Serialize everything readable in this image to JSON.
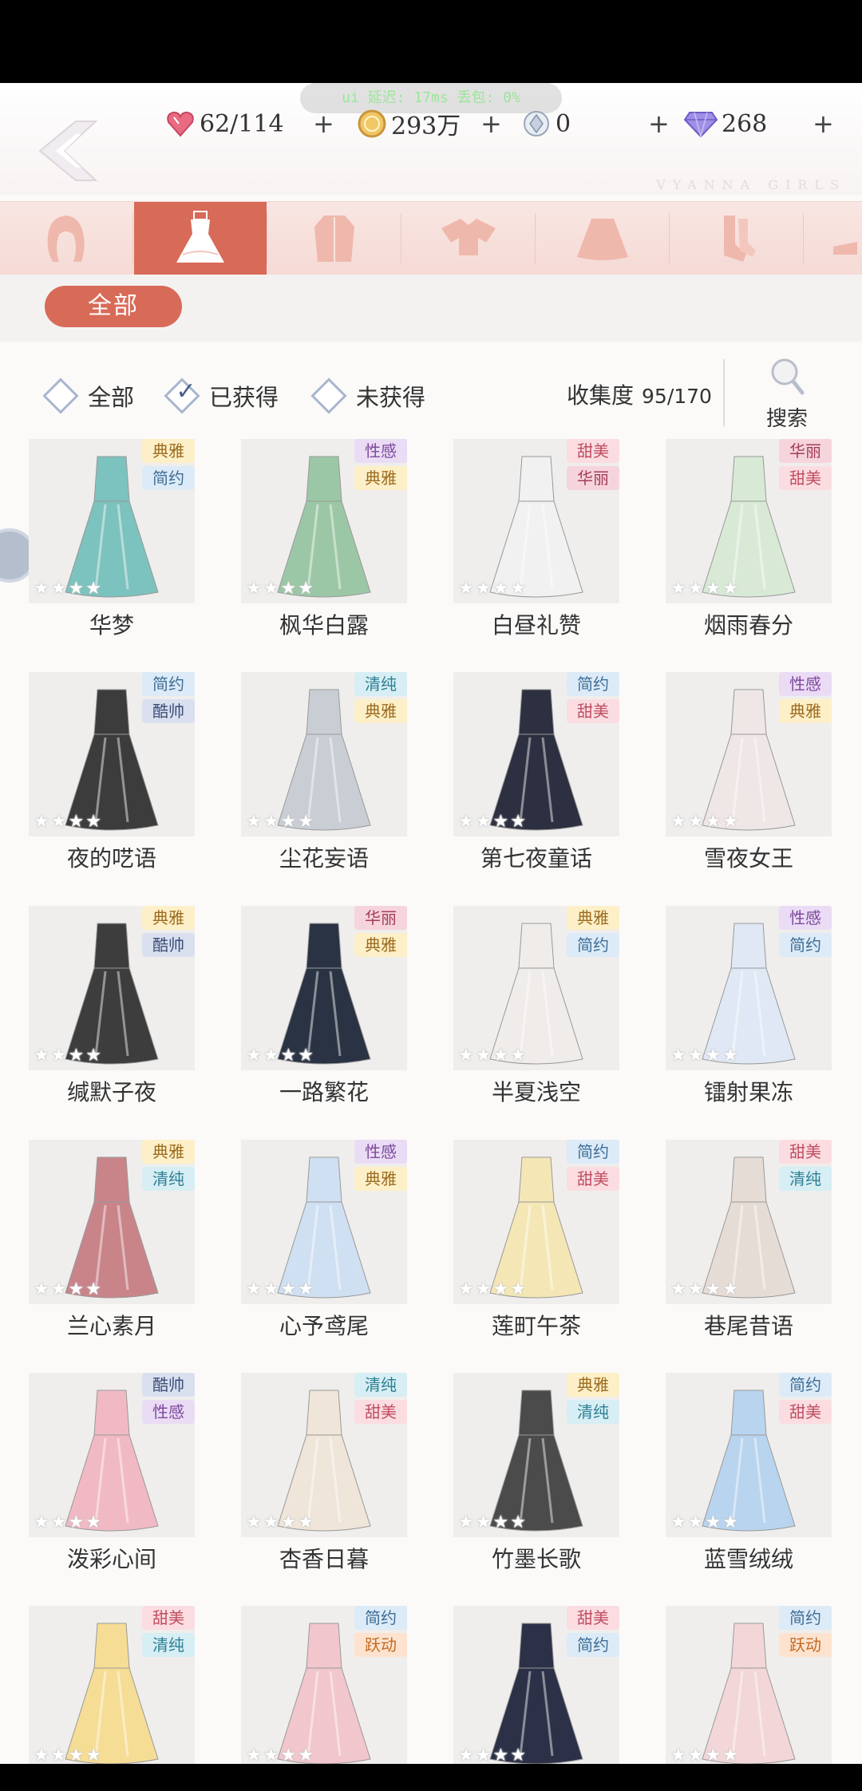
{
  "overlay": {
    "text": "ui 延迟: 17ms  丢包: 0%"
  },
  "currency": [
    {
      "icon": "heart-gem-icon",
      "value": "62/114",
      "color": "#e0566f"
    },
    {
      "icon": "gold-coin-icon",
      "value": "293万",
      "color": "#e1b35b"
    },
    {
      "icon": "crystal-icon",
      "value": "0",
      "color": "#b7c1cf"
    },
    {
      "icon": "diamond-icon",
      "value": "268",
      "color": "#8a7ad8"
    }
  ],
  "watermark": "VYANNA GIRLS",
  "categories": [
    {
      "icon": "hair-icon"
    },
    {
      "icon": "dress-icon"
    },
    {
      "icon": "coat-icon"
    },
    {
      "icon": "top-icon"
    },
    {
      "icon": "skirt-icon"
    },
    {
      "icon": "socks-icon"
    },
    {
      "icon": "shoes-icon"
    }
  ],
  "subcategory": {
    "label": "全部"
  },
  "filters": [
    {
      "label": "全部",
      "checked": false
    },
    {
      "label": "已获得",
      "checked": true
    },
    {
      "label": "未获得",
      "checked": false
    }
  ],
  "collection": {
    "label": "收集度",
    "value": "95/170"
  },
  "search": {
    "label": "搜索"
  },
  "tag_colors": {
    "典雅": {
      "bg": "#fdf0c8",
      "fg": "#9c6b1f"
    },
    "简约": {
      "bg": "#dcebf7",
      "fg": "#3f6d96"
    },
    "性感": {
      "bg": "#eadcf5",
      "fg": "#7d4a9c"
    },
    "甜美": {
      "bg": "#fbdde1",
      "fg": "#c04e62"
    },
    "华丽": {
      "bg": "#f6d4dc",
      "fg": "#a43d5b"
    },
    "清纯": {
      "bg": "#d6eef4",
      "fg": "#2e7f93"
    },
    "酷帅": {
      "bg": "#dae0ef",
      "fg": "#3b4f7a"
    },
    "跃动": {
      "bg": "#fde3cf",
      "fg": "#c46a24"
    }
  },
  "items": [
    {
      "name": "华梦",
      "tags": [
        "典雅",
        "简约"
      ],
      "color": "#7cc2be"
    },
    {
      "name": "枫华白露",
      "tags": [
        "性感",
        "典雅"
      ],
      "color": "#9cc7a6"
    },
    {
      "name": "白昼礼赞",
      "tags": [
        "甜美",
        "华丽"
      ],
      "color": "#f1f1f1"
    },
    {
      "name": "烟雨春分",
      "tags": [
        "华丽",
        "甜美"
      ],
      "color": "#d8ead6"
    },
    {
      "name": "夜的呓语",
      "tags": [
        "简约",
        "酷帅"
      ],
      "color": "#3c3c3c"
    },
    {
      "name": "尘花妄语",
      "tags": [
        "清纯",
        "典雅"
      ],
      "color": "#c9ced4"
    },
    {
      "name": "第七夜童话",
      "tags": [
        "简约",
        "甜美"
      ],
      "color": "#2d3040"
    },
    {
      "name": "雪夜女王",
      "tags": [
        "性感",
        "典雅"
      ],
      "color": "#efe6e6"
    },
    {
      "name": "缄默子夜",
      "tags": [
        "典雅",
        "酷帅"
      ],
      "color": "#3d3d3d"
    },
    {
      "name": "一路繁花",
      "tags": [
        "华丽",
        "典雅"
      ],
      "color": "#2a3344"
    },
    {
      "name": "半夏浅空",
      "tags": [
        "典雅",
        "简约"
      ],
      "color": "#f0ecea"
    },
    {
      "name": "镭射果冻",
      "tags": [
        "性感",
        "简约"
      ],
      "color": "#dfe8f4"
    },
    {
      "name": "兰心素月",
      "tags": [
        "典雅",
        "清纯"
      ],
      "color": "#c9848a"
    },
    {
      "name": "心予鸢尾",
      "tags": [
        "性感",
        "典雅"
      ],
      "color": "#cfe0f3"
    },
    {
      "name": "莲町午茶",
      "tags": [
        "简约",
        "甜美"
      ],
      "color": "#f4e7b5"
    },
    {
      "name": "巷尾昔语",
      "tags": [
        "甜美",
        "清纯"
      ],
      "color": "#e6dcd6"
    },
    {
      "name": "泼彩心间",
      "tags": [
        "酷帅",
        "性感"
      ],
      "color": "#f1b9c4"
    },
    {
      "name": "杏香日暮",
      "tags": [
        "清纯",
        "甜美"
      ],
      "color": "#efe5d9"
    },
    {
      "name": "竹墨长歌",
      "tags": [
        "典雅",
        "清纯"
      ],
      "color": "#4b4b4b"
    },
    {
      "name": "蓝雪绒绒",
      "tags": [
        "简约",
        "甜美"
      ],
      "color": "#b9d4ee"
    },
    {
      "name": "",
      "tags": [
        "甜美",
        "清纯"
      ],
      "color": "#f6dd95"
    },
    {
      "name": "",
      "tags": [
        "简约",
        "跃动"
      ],
      "color": "#f1c6cd"
    },
    {
      "name": "",
      "tags": [
        "甜美",
        "简约"
      ],
      "color": "#2c3148"
    },
    {
      "name": "",
      "tags": [
        "简约",
        "跃动"
      ],
      "color": "#f3d6d8"
    }
  ]
}
